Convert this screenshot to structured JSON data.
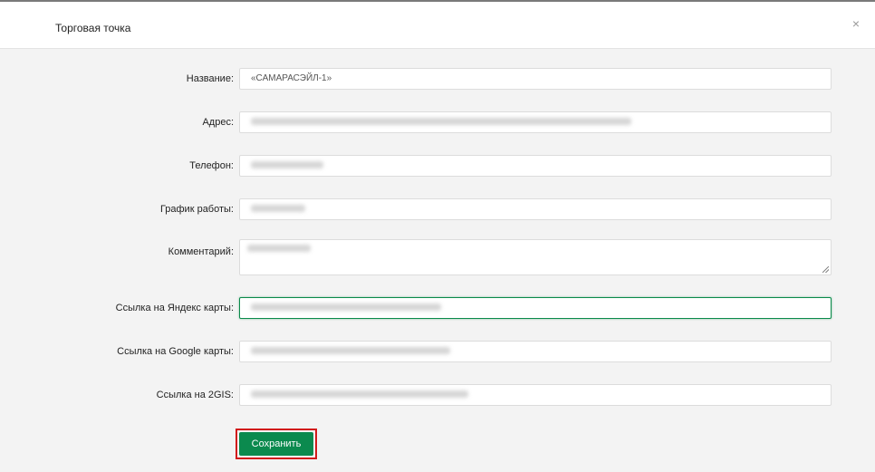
{
  "modal": {
    "title": "Торговая точка",
    "close_glyph": "×"
  },
  "form": {
    "fields": [
      {
        "label": "Название:",
        "value": "«САМАРАСЭЙЛ-1»"
      },
      {
        "label": "Адрес:",
        "value": ""
      },
      {
        "label": "Телефон:",
        "value": ""
      },
      {
        "label": "График работы:",
        "value": ""
      },
      {
        "label": "Комментарий:",
        "value": ""
      },
      {
        "label": "Ссылка на Яндекс карты:",
        "value": ""
      },
      {
        "label": "Ссылка на Google карты:",
        "value": ""
      },
      {
        "label": "Ссылка на 2GIS:",
        "value": ""
      }
    ],
    "save_label": "Сохранить"
  },
  "colors": {
    "accent": "#0b8a4e",
    "highlight_border": "#d11a1a",
    "body_bg": "#f3f3f3"
  },
  "icons": {
    "close": "close-icon"
  }
}
